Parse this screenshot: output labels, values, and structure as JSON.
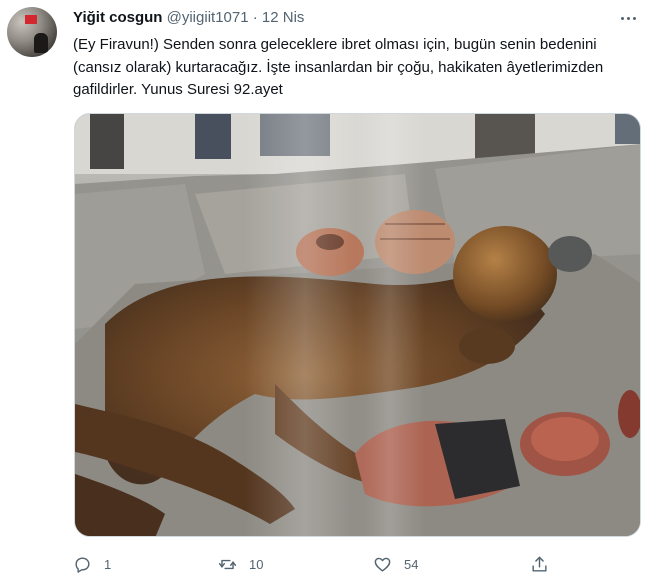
{
  "author": {
    "display_name": "Yiğit cosgun",
    "handle": "@yiigiit1071",
    "separator": "·",
    "date": "12 Nis"
  },
  "tweet": {
    "text": "(Ey Firavun!) Senden sonra geleceklere ibret olması için, bugün senin bedenini (cansız olarak) kurtaracağız. İşte insanlardan bir çoğu, hakikaten âyetlerimizden gafildirler. Yunus Suresi 92.ayet"
  },
  "actions": {
    "reply_count": "1",
    "retweet_count": "10",
    "like_count": "54"
  },
  "icons": {
    "more": "more-horizontal-icon",
    "reply": "reply-icon",
    "retweet": "retweet-icon",
    "like": "heart-icon",
    "share": "share-icon"
  },
  "colors": {
    "text": "#0f1419",
    "secondary": "#536471",
    "border": "#cfd9de"
  }
}
